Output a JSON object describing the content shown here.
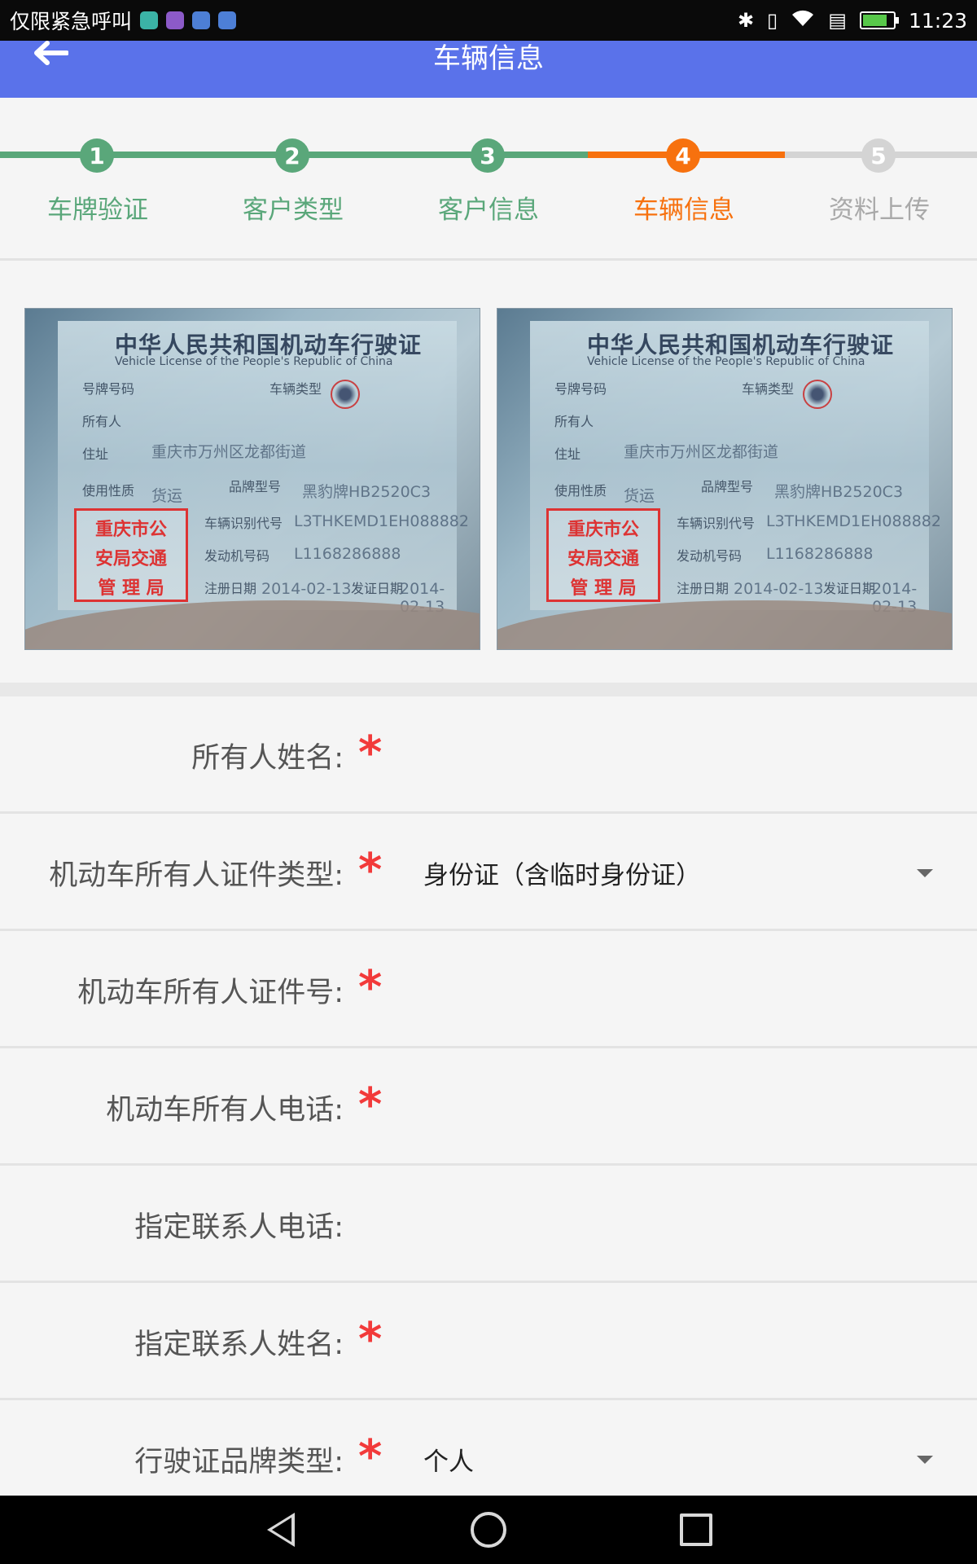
{
  "status_bar": {
    "carrier": "仅限紧急呼叫",
    "time": "11:23",
    "app_icons": [
      "android-icon",
      "gallery-icon",
      "sim-icon",
      "sim-icon"
    ],
    "icons": [
      "bluetooth-icon",
      "vibrate-icon",
      "wifi-icon",
      "battery-icon"
    ],
    "battery_level": 0.8
  },
  "header": {
    "title": "车辆信息",
    "back_icon": "back-arrow-icon"
  },
  "stepper": {
    "steps": [
      {
        "number": "1",
        "label": "车牌验证",
        "state": "done"
      },
      {
        "number": "2",
        "label": "客户类型",
        "state": "done"
      },
      {
        "number": "3",
        "label": "客户信息",
        "state": "done"
      },
      {
        "number": "4",
        "label": "车辆信息",
        "state": "active"
      },
      {
        "number": "5",
        "label": "资料上传",
        "state": "pending"
      }
    ],
    "colors": {
      "done": "#5aa77a",
      "active": "#f7710e",
      "pending": "#d4d4d4"
    }
  },
  "photos": [
    {
      "title": "中华人民共和国机动车行驶证",
      "subtitle": "Vehicle License of the People's Republic of China",
      "fields": {
        "plate_label": "号牌号码",
        "type_label": "车辆类型",
        "owner_label": "所有人",
        "address_label": "住址",
        "address_value": "重庆市万州区龙都街道",
        "use_label": "使用性质",
        "use_value": "货运",
        "model_label": "品牌型号",
        "model_value": "黑豹牌HB2520C3",
        "vin_label": "车辆识别代号",
        "vin_value": "L3THKEMD1EH088882",
        "engine_label": "发动机号码",
        "engine_value": "L1168286888",
        "reg_label": "注册日期",
        "reg_value": "2014-02-13",
        "issue_label": "发证日期",
        "issue_value": "2014-02-13"
      },
      "stamp": [
        "重庆市公",
        "安局交通",
        "管 理 局"
      ]
    },
    {
      "title": "中华人民共和国机动车行驶证",
      "subtitle": "Vehicle License of the People's Republic of China",
      "fields": {
        "plate_label": "号牌号码",
        "type_label": "车辆类型",
        "owner_label": "所有人",
        "address_label": "住址",
        "address_value": "重庆市万州区龙都街道",
        "use_label": "使用性质",
        "use_value": "货运",
        "model_label": "品牌型号",
        "model_value": "黑豹牌HB2520C3",
        "vin_label": "车辆识别代号",
        "vin_value": "L3THKEMD1EH088882",
        "engine_label": "发动机号码",
        "engine_value": "L1168286888",
        "reg_label": "注册日期",
        "reg_value": "2014-02-13",
        "issue_label": "发证日期",
        "issue_value": "2014-02-13"
      },
      "stamp": [
        "重庆市公",
        "安局交通",
        "管 理 局"
      ]
    }
  ],
  "form": {
    "rows": [
      {
        "label": "所有人姓名:",
        "required": "*",
        "value": ""
      },
      {
        "label": "机动车所有人证件类型:",
        "required": "*",
        "value": "身份证（含临时身份证）",
        "dropdown": true
      },
      {
        "label": "机动车所有人证件号:",
        "required": "*",
        "value": ""
      },
      {
        "label": "机动车所有人电话:",
        "required": "*",
        "value": ""
      },
      {
        "label": "指定联系人电话:",
        "required": "",
        "value": ""
      },
      {
        "label": "指定联系人姓名:",
        "required": "*",
        "value": ""
      },
      {
        "label": "行驶证品牌类型:",
        "required": "*",
        "value": "个人",
        "dropdown": true
      }
    ],
    "required_color": "#f23a3a"
  },
  "nav_bar": {
    "icons": [
      "nav-back-icon",
      "nav-home-icon",
      "nav-recents-icon"
    ]
  }
}
